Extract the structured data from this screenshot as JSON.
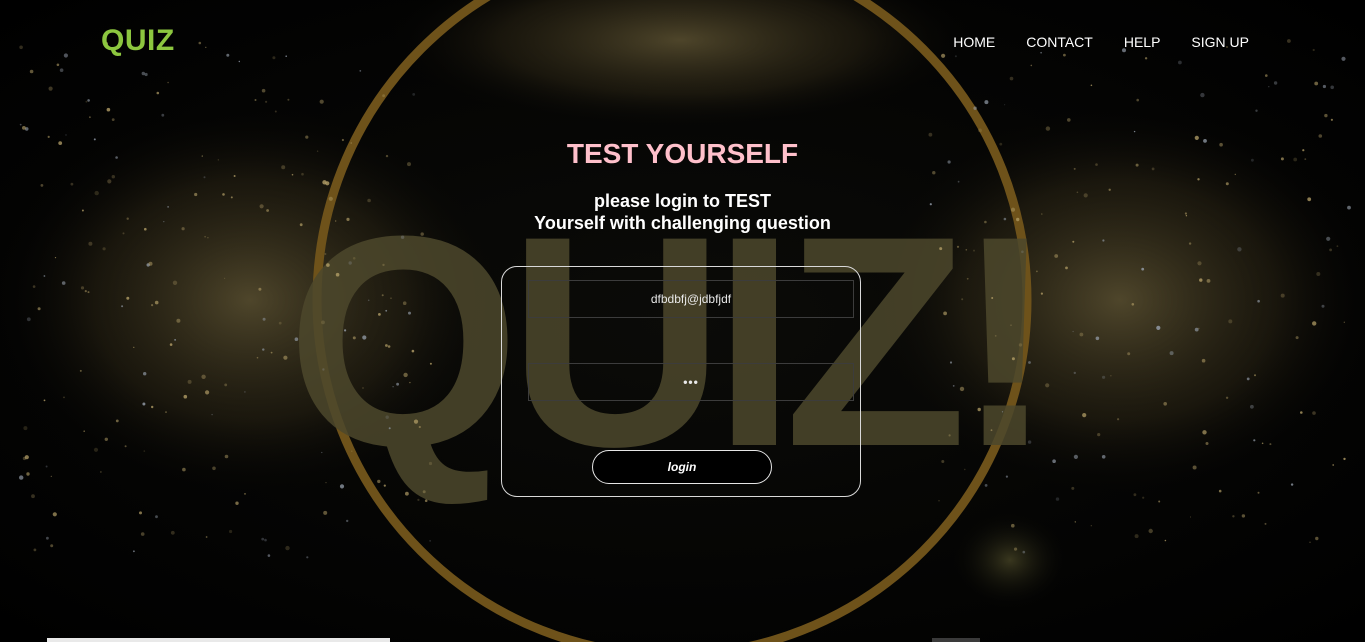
{
  "header": {
    "logo": "QUIZ",
    "nav": [
      {
        "label": "HOME"
      },
      {
        "label": "CONTACT"
      },
      {
        "label": "HELP"
      },
      {
        "label": "SIGN UP"
      }
    ]
  },
  "hero": {
    "title": "TEST YOURSELF",
    "subtitle_line1": "please login to TEST",
    "subtitle_line2": "Yourself with challenging question",
    "background_text": "QUIZ!"
  },
  "login_form": {
    "email_value": "dfbdbfj@jdbfjdf",
    "password_value": "•••",
    "submit_label": "login"
  },
  "colors": {
    "logo": "#8cc63f",
    "title": "#ffc0cb",
    "text": "#ffffff",
    "ring": "#7a5a1a",
    "bg_text": "#5c5635"
  }
}
